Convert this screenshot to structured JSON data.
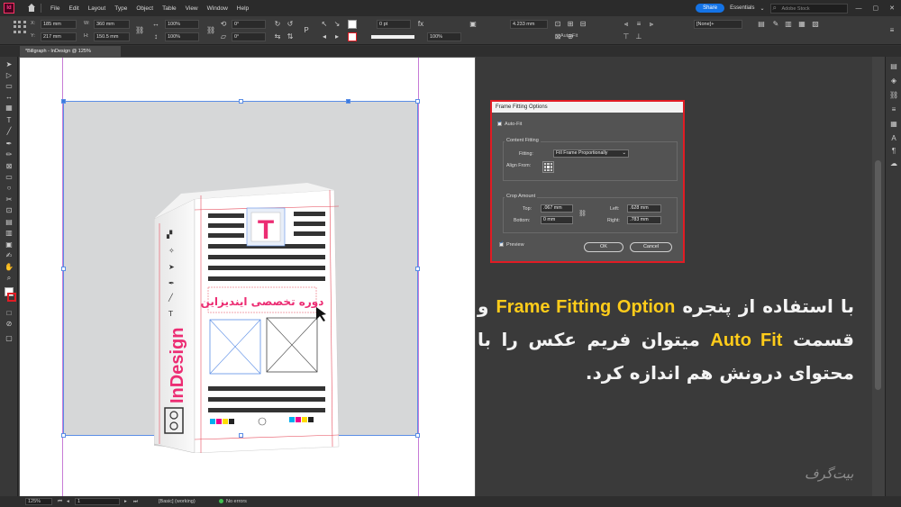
{
  "app": {
    "logo": "Id",
    "menus": [
      "File",
      "Edit",
      "Layout",
      "Type",
      "Object",
      "Table",
      "View",
      "Window",
      "Help"
    ],
    "share_label": "Share",
    "workspace": "Essentials",
    "stock_placeholder": "Adobe Stock"
  },
  "control": {
    "x_label": "X:",
    "x": "185 mm",
    "y_label": "Y:",
    "y": "217 mm",
    "w_label": "W:",
    "w": "360 mm",
    "h_label": "H:",
    "h": "150.5 mm",
    "scale_x": "100%",
    "scale_y": "100%",
    "rotate": "0°",
    "shear": "0°",
    "stroke_weight": "0 pt",
    "opacity": "100%",
    "fitting_value": "4.233 mm",
    "autofit_label": "Auto-Fit",
    "style_select": "[None]+"
  },
  "document": {
    "tab_title": "*Billgraph - InDesign @ 125%"
  },
  "box": {
    "brand": "InDesign",
    "title_persian": "دوره تخصصی ایندیزاین",
    "t_letter": "T"
  },
  "dialog": {
    "title": "Frame Fitting Options",
    "autofit_label": "Auto-Fit",
    "content_fitting_label": "Content Fitting",
    "fitting_label": "Fitting:",
    "fitting_value": "Fill Frame Proportionally",
    "align_from_label": "Align From:",
    "crop_amount_label": "Crop Amount",
    "top_label": "Top:",
    "top_value": ".067 mm",
    "bottom_label": "Bottom:",
    "bottom_value": "0 mm",
    "left_label": "Left:",
    "left_value": ".628 mm",
    "right_label": "Right:",
    "right_value": ".783 mm",
    "preview_label": "Preview",
    "ok_label": "OK",
    "cancel_label": "Cancel"
  },
  "caption": {
    "part1": "با استفاده از پنجره",
    "hl1": "Frame Fitting Option",
    "part2": "و قسمت",
    "hl2": "Auto Fit",
    "part3": "میتوان فریم عکس را با محتوای درونش هم اندازه کرد."
  },
  "watermark": "بیت‌گرف",
  "status": {
    "zoom": "125%",
    "page": "1",
    "style": "[Basic] (working)",
    "errors": "No errors"
  },
  "colors": {
    "accent": "#1473e6",
    "dialog_border": "#e11c24",
    "highlight": "#ffcc1a",
    "frame": "#5b8ee6"
  }
}
